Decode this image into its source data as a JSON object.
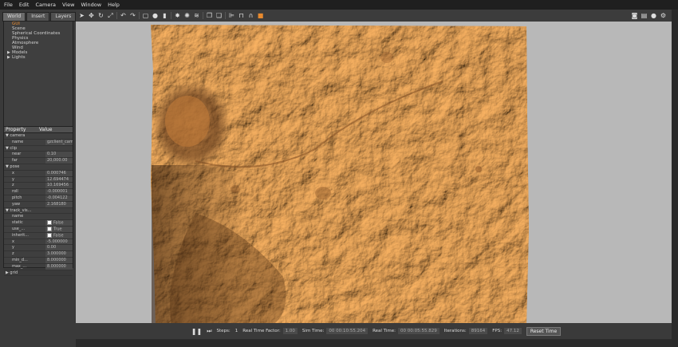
{
  "menu": [
    "File",
    "Edit",
    "Camera",
    "View",
    "Window",
    "Help"
  ],
  "tabs": [
    "World",
    "Insert",
    "Layers"
  ],
  "world_tree": [
    {
      "label": "GUI",
      "arrow": ""
    },
    {
      "label": "Scene",
      "arrow": ""
    },
    {
      "label": "Spherical Coordinates",
      "arrow": ""
    },
    {
      "label": "Physics",
      "arrow": ""
    },
    {
      "label": "Atmosphere",
      "arrow": ""
    },
    {
      "label": "Wind",
      "arrow": ""
    },
    {
      "label": "Models",
      "arrow": "▶"
    },
    {
      "label": "Lights",
      "arrow": "▶"
    }
  ],
  "props_header": {
    "property": "Property",
    "value": "Value"
  },
  "props": [
    {
      "k": "▼ camera",
      "v": ""
    },
    {
      "k": "name",
      "v": "gzclient_camera"
    },
    {
      "k": "▼ clip",
      "v": ""
    },
    {
      "k": "near",
      "v": "0.10"
    },
    {
      "k": "far",
      "v": "20,000.00"
    },
    {
      "k": "▼ pose",
      "v": ""
    },
    {
      "k": "x",
      "v": "0.000746"
    },
    {
      "k": "y",
      "v": "12.694474"
    },
    {
      "k": "z",
      "v": "10.169456"
    },
    {
      "k": "roll",
      "v": "-0.000001"
    },
    {
      "k": "pitch",
      "v": "-0.004122"
    },
    {
      "k": "yaw",
      "v": "2.168180"
    },
    {
      "k": "▼ track_vis...",
      "v": ""
    },
    {
      "k": "name",
      "v": ""
    },
    {
      "k": "static",
      "v": "False",
      "cb": true
    },
    {
      "k": "use_...",
      "v": "True",
      "cb": true
    },
    {
      "k": "inherit...",
      "v": "False",
      "cb": true
    },
    {
      "k": "x",
      "v": "-5.000000"
    },
    {
      "k": "y",
      "v": "0.00"
    },
    {
      "k": "z",
      "v": "3.000000"
    },
    {
      "k": "min_d...",
      "v": "8.000000"
    },
    {
      "k": "max_...",
      "v": "8.000000"
    },
    {
      "k": "▶ grid",
      "v": ""
    }
  ],
  "bottom": {
    "steps_label": "Steps:",
    "steps_value": "1",
    "rtf_label": "Real Time Factor:",
    "rtf_value": "1.00",
    "sim_label": "Sim Time:",
    "sim_value": "00 00:10:55.204",
    "real_label": "Real Time:",
    "real_value": "00 00:05:55.829",
    "iter_label": "Iterations:",
    "iter_value": "89164",
    "fps_label": "FPS:",
    "fps_value": "47.12",
    "reset_label": "Reset Time"
  },
  "colors": {
    "terrain": "#d98e45",
    "terrain_shadow": "#6e4220",
    "selected": "#e88a2e"
  }
}
